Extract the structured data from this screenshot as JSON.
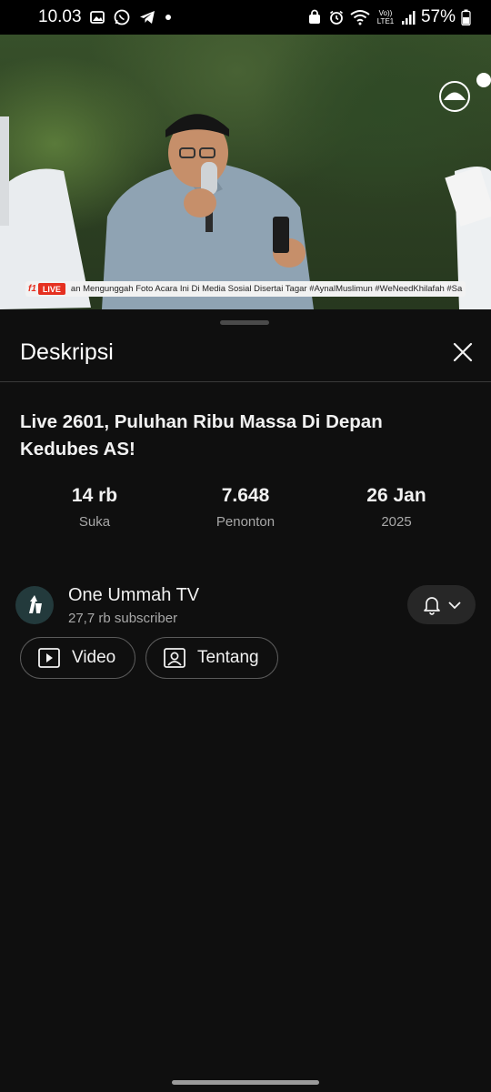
{
  "status_bar": {
    "time": "10.03",
    "battery": "57%",
    "network": "Vo)) LTE1"
  },
  "video": {
    "live_badge": "LIVE",
    "ticker_text": "an Mengunggah Foto Acara Ini Di Media Sosial Disertai Tagar #AynalMuslimun #WeNeedKhilafah #Sa"
  },
  "panel": {
    "title": "Deskripsi",
    "video_title": "Live 2601, Puluhan Ribu Massa Di Depan Kedubes AS!",
    "stats": [
      {
        "value": "14 rb",
        "label": "Suka"
      },
      {
        "value": "7.648",
        "label": "Penonton"
      },
      {
        "value": "26 Jan",
        "label": "2025"
      }
    ],
    "channel": {
      "name": "One Ummah TV",
      "subscribers": "27,7 rb subscriber"
    },
    "chips": [
      {
        "label": "Video",
        "icon": "play-video-icon"
      },
      {
        "label": "Tentang",
        "icon": "person-card-icon"
      }
    ]
  },
  "colors": {
    "background": "#0f0f0f",
    "live_red": "#e53020",
    "secondary_text": "#a8a8a8"
  }
}
